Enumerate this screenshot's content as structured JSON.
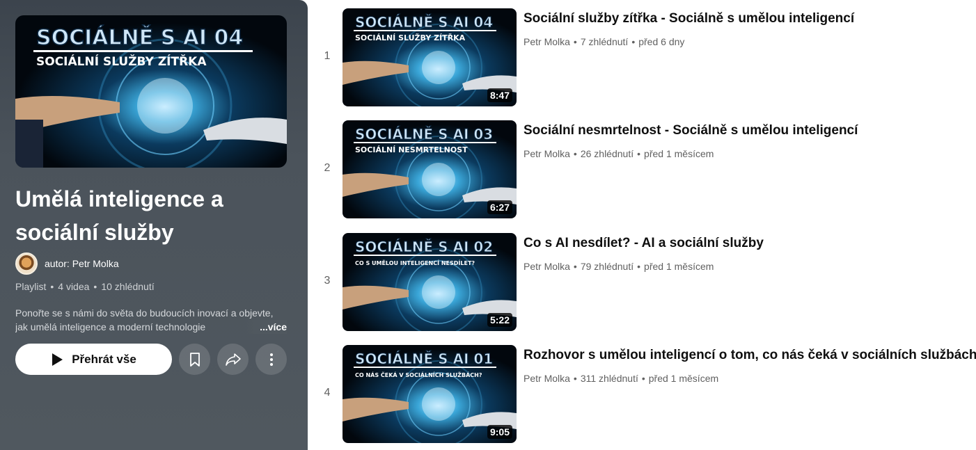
{
  "playlist": {
    "title": "Umělá inteligence a sociální služby",
    "author": "autor: Petr Molka",
    "type": "Playlist",
    "video_count": "4 videa",
    "views": "10 zhlédnutí",
    "description": "Ponořte se s námi do světa do budoucích inovací a objevte, jak umělá inteligence a moderní technologie",
    "more_label": "...více",
    "play_all_label": "Přehrát vše",
    "hero_thumb": {
      "line1": "SOCIÁLNĚ S AI 04",
      "line2": "SOCIÁLNÍ SLUŽBY ZÍTŘKA"
    }
  },
  "videos": [
    {
      "index": "1",
      "title": "Sociální služby zítřka - Sociálně s umělou inteligencí",
      "channel": "Petr Molka",
      "views": "7 zhlédnutí",
      "age": "před 6 dny",
      "duration": "8:47",
      "thumb_line1": "SOCIÁLNĚ S AI 04",
      "thumb_line2": "SOCIÁLNÍ SLUŽBY ZÍTŘKA"
    },
    {
      "index": "2",
      "title": "Sociální nesmrtelnost - Sociálně s umělou inteligencí",
      "channel": "Petr Molka",
      "views": "26 zhlédnutí",
      "age": "před 1 měsícem",
      "duration": "6:27",
      "thumb_line1": "SOCIÁLNĚ S AI 03",
      "thumb_line2": "SOCIÁLNÍ NESMRTELNOST"
    },
    {
      "index": "3",
      "title": "Co s AI nesdílet? - AI a sociální služby",
      "channel": "Petr Molka",
      "views": "79 zhlédnutí",
      "age": "před 1 měsícem",
      "duration": "5:22",
      "thumb_line1": "SOCIÁLNĚ S AI 02",
      "thumb_line2": "CO S UMĚLOU INTELIGENCÍ NESDÍLET?"
    },
    {
      "index": "4",
      "title": "Rozhovor s umělou inteligencí o tom, co nás čeká v sociálních službách",
      "channel": "Petr Molka",
      "views": "311 zhlédnutí",
      "age": "před 1 měsícem",
      "duration": "9:05",
      "thumb_line1": "SOCIÁLNĚ S AI 01",
      "thumb_line2": "CO NÁS ČEKÁ V SOCIÁLNÍCH SLUŽBÁCH?"
    }
  ],
  "separator": "•",
  "colors": {
    "panel_bg": "#4b535b",
    "title_text": "#0f0f0f",
    "meta_text": "#606060"
  },
  "icons": {
    "play": "play-icon",
    "save": "bookmark-icon",
    "share": "share-icon",
    "more": "more-vertical-icon"
  }
}
